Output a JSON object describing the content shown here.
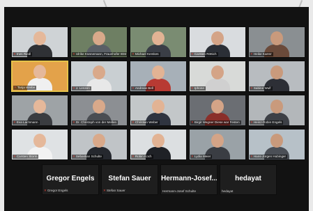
{
  "participants": [
    {
      "name": "Ines Riedl"
    },
    {
      "name": "Ulrike Künnemann, Fraunhofer IEM"
    },
    {
      "name": "Michael Kemkes"
    },
    {
      "name": "Carsten Röttich"
    },
    {
      "name": "Heike Karrer"
    },
    {
      "name": "Tanja Wiebe"
    },
    {
      "name": "J. Lenzen"
    },
    {
      "name": "Andreas Bell"
    },
    {
      "name": "Iphone"
    },
    {
      "name": "Sabine Wulf"
    },
    {
      "name": "Eva Lachmann"
    },
    {
      "name": "Dr. Christoph von der Mellen"
    },
    {
      "name": "Christian Weber"
    },
    {
      "name": "Birgit Wegner Diese war Festen"
    },
    {
      "name": "Heinz-Robin Engels"
    },
    {
      "name": "Carsten Storm"
    },
    {
      "name": "Sebastian Schulte"
    },
    {
      "name": "Robin Koch"
    },
    {
      "name": "Lydia Meier"
    },
    {
      "name": "Hans-Jürgen Hubinger"
    }
  ],
  "audio_participants": [
    {
      "display": "Gregor Engels",
      "label": "Gregor Engels"
    },
    {
      "display": "Stefan Sauer",
      "label": "Stefan Sauer"
    },
    {
      "display": "Hermann-Josef...",
      "label": "Hermann-Josef Schulte"
    },
    {
      "display": "hedayat",
      "label": "hedayat"
    }
  ]
}
